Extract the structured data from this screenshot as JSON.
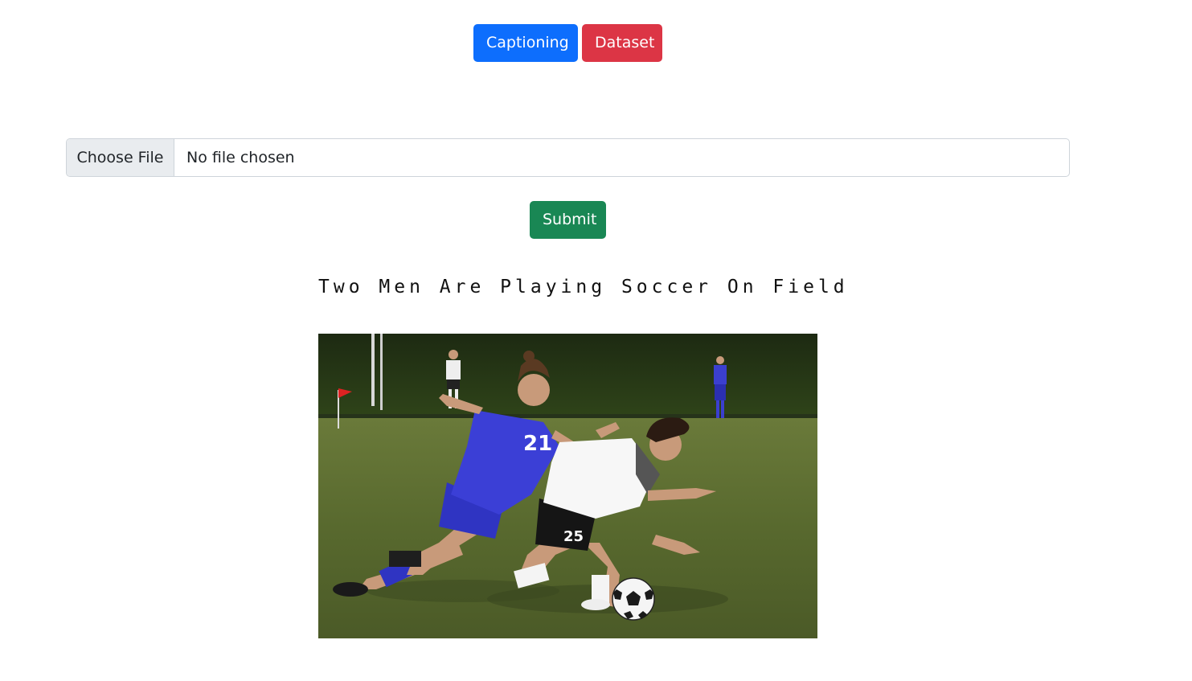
{
  "nav": {
    "captioning_label": "Captioning",
    "dataset_label": "Dataset"
  },
  "upload": {
    "choose_label": "Choose File",
    "status_text": "No file chosen"
  },
  "form": {
    "submit_label": "Submit"
  },
  "result": {
    "caption": "Two Men Are Playing Soccer On Field",
    "player_jersey_blue": "21",
    "player_jersey_white": "25"
  },
  "colors": {
    "primary": "#0d6efd",
    "danger": "#dc3545",
    "success": "#198754"
  }
}
